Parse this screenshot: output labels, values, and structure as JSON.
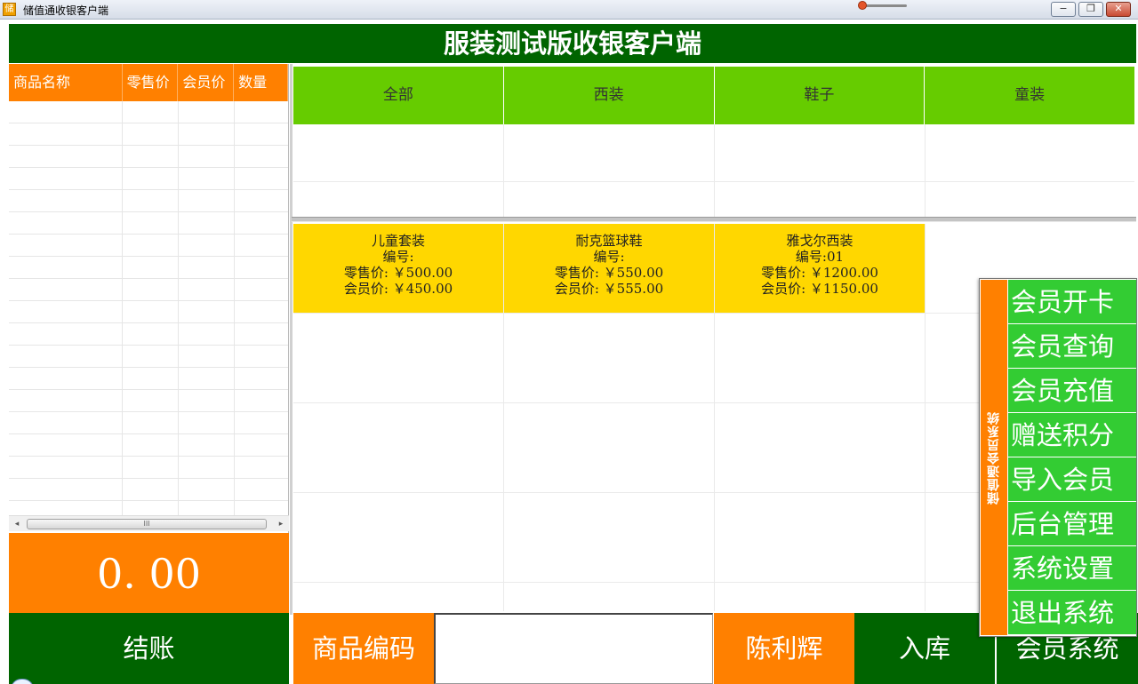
{
  "window": {
    "title": "储值通收银客户端",
    "app_icon": "储",
    "minimize": "−",
    "restore": "❐",
    "close": "✕"
  },
  "header": {
    "title": "服装测试版收银客户端"
  },
  "order_grid": {
    "columns": [
      "商品名称",
      "零售价",
      "会员价",
      "数量"
    ],
    "rows": []
  },
  "scrollbar": {
    "left": "◂",
    "right": "▸",
    "thumb": "III"
  },
  "total": "0. 00",
  "categories": [
    "全部",
    "西装",
    "鞋子",
    "童装"
  ],
  "products": [
    {
      "name": "儿童套装",
      "code_label": "编号:",
      "retail": "零售价: ￥500.00",
      "member": "会员价: ￥450.00"
    },
    {
      "name": "耐克篮球鞋",
      "code_label": "编号:",
      "retail": "零售价: ￥550.00",
      "member": "会员价: ￥555.00"
    },
    {
      "name": "雅戈尔西装",
      "code_label": "编号:01",
      "retail": "零售价: ￥1200.00",
      "member": "会员价: ￥1150.00"
    }
  ],
  "bottom": {
    "checkout": "结账",
    "code_label": "商品编码",
    "code_value": "",
    "user": "陈利辉",
    "stock_in": "入库",
    "member_system": "会员系统"
  },
  "member_menu": {
    "title": "储值通会员系统",
    "items": [
      "会员开卡",
      "会员查询",
      "会员充值",
      "赠送积分",
      "导入会员",
      "后台管理",
      "系统设置",
      "退出系统"
    ]
  }
}
